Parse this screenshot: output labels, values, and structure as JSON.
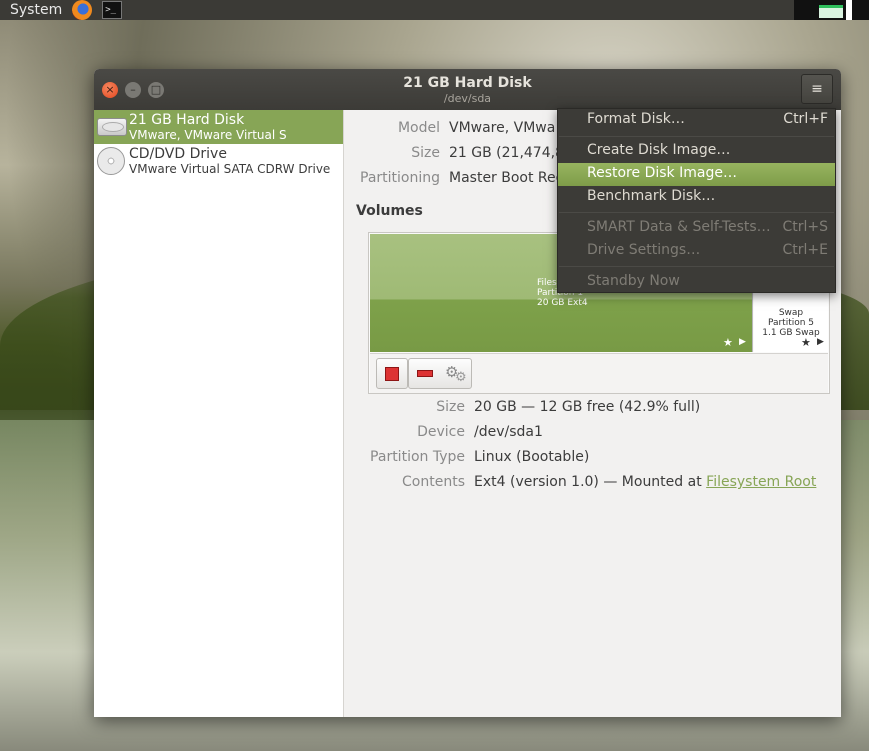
{
  "panel": {
    "system_menu": "System",
    "terminal_label": ">_"
  },
  "window": {
    "title": "21 GB Hard Disk",
    "subtitle": "/dev/sda",
    "close_symbol": "×",
    "minimize_symbol": "–",
    "maximize_symbol": "□",
    "menu_symbol": "≡"
  },
  "sidebar": {
    "drives": [
      {
        "name": "21 GB Hard Disk",
        "sub": "VMware, VMware Virtual S",
        "icon": "hard-disk-icon",
        "selected": true
      },
      {
        "name": "CD/DVD Drive",
        "sub": "VMware Virtual SATA CDRW Drive",
        "icon": "optical-disc-icon",
        "selected": false
      }
    ]
  },
  "drive_info": {
    "model_key": "Model",
    "model_val": "VMware, VMwa",
    "size_key": "Size",
    "size_val": "21 GB (21,474,83",
    "partitioning_key": "Partitioning",
    "partitioning_val": "Master Boot Rec"
  },
  "volumes": {
    "title": "Volumes",
    "main_partition": {
      "line1": "Files",
      "line2": "Partition 1",
      "line3": "20 GB Ext4"
    },
    "swap_partition": {
      "line1": "Swap",
      "line2": "Partition 5",
      "line3": "1.1 GB Swap"
    },
    "star_glyph": "★",
    "arrow_glyph": "▶"
  },
  "partition_details": {
    "size_key": "Size",
    "size_val": "20 GB — 12 GB free (42.9% full)",
    "device_key": "Device",
    "device_val": "/dev/sda1",
    "type_key": "Partition Type",
    "type_val": "Linux (Bootable)",
    "contents_key": "Contents",
    "contents_val": "Ext4 (version 1.0) — Mounted at ",
    "contents_link": "Filesystem Root"
  },
  "menu": {
    "items": [
      {
        "label": "Format Disk…",
        "accel": "Ctrl+F",
        "state": "normal"
      },
      {
        "label": "Create Disk Image…",
        "accel": "",
        "state": "normal"
      },
      {
        "label": "Restore Disk Image…",
        "accel": "",
        "state": "highlighted"
      },
      {
        "label": "Benchmark Disk…",
        "accel": "",
        "state": "normal"
      },
      {
        "label": "SMART Data & Self-Tests…",
        "accel": "Ctrl+S",
        "state": "disabled"
      },
      {
        "label": "Drive Settings…",
        "accel": "Ctrl+E",
        "state": "disabled"
      },
      {
        "label": "Standby Now",
        "accel": "",
        "state": "disabled"
      }
    ]
  },
  "colors": {
    "accent": "#87a556",
    "panel_bg": "#3b3a36",
    "close_button": "#e2461e",
    "stop_red": "#dd3333"
  }
}
